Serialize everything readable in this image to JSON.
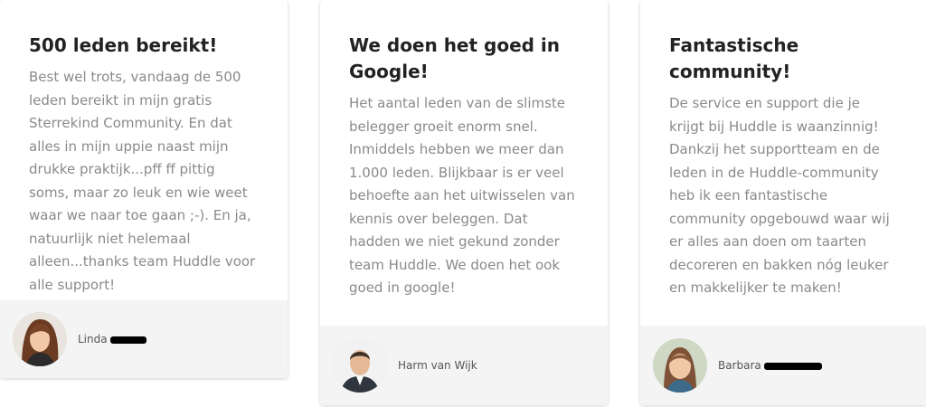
{
  "testimonials": [
    {
      "title": "500 leden bereikt!",
      "text": "Best wel trots, vandaag de 500 leden bereikt in mijn gratis Sterrekind Community. En dat alles in mijn uppie naast mijn drukke praktijk...pff ff pittig soms, maar zo leuk en wie weet waar we naar toe gaan ;-). En ja, natuurlijk niet helemaal alleen...thanks team Huddle voor alle support!",
      "author": "Linda",
      "avatar_icon": "woman-portrait"
    },
    {
      "title": "We doen het goed in Google!",
      "text": "Het aantal leden van de slimste belegger groeit enorm snel. Inmiddels hebben we meer dan 1.000 leden. Blijkbaar is er veel behoefte aan het uitwisselen van kennis over beleggen. Dat hadden we niet gekund zonder team Huddle. We doen het ook goed in google!",
      "author": "Harm van Wijk",
      "avatar_icon": "man-portrait"
    },
    {
      "title": "Fantastische community!",
      "text": "De service en support die je krijgt bij Huddle is waanzinnig! Dankzij het supportteam en de leden in de Huddle-community heb ik een fantastische community opgebouwd waar wij er alles aan doen om taarten decoreren en bakken nóg leuker en makkelijker te maken!",
      "author": "Barbara",
      "avatar_icon": "woman-portrait"
    }
  ],
  "colors": {
    "title": "#222222",
    "text": "#8a8a8a",
    "footer_bg": "#f4f4f4",
    "card_bg": "#ffffff"
  }
}
